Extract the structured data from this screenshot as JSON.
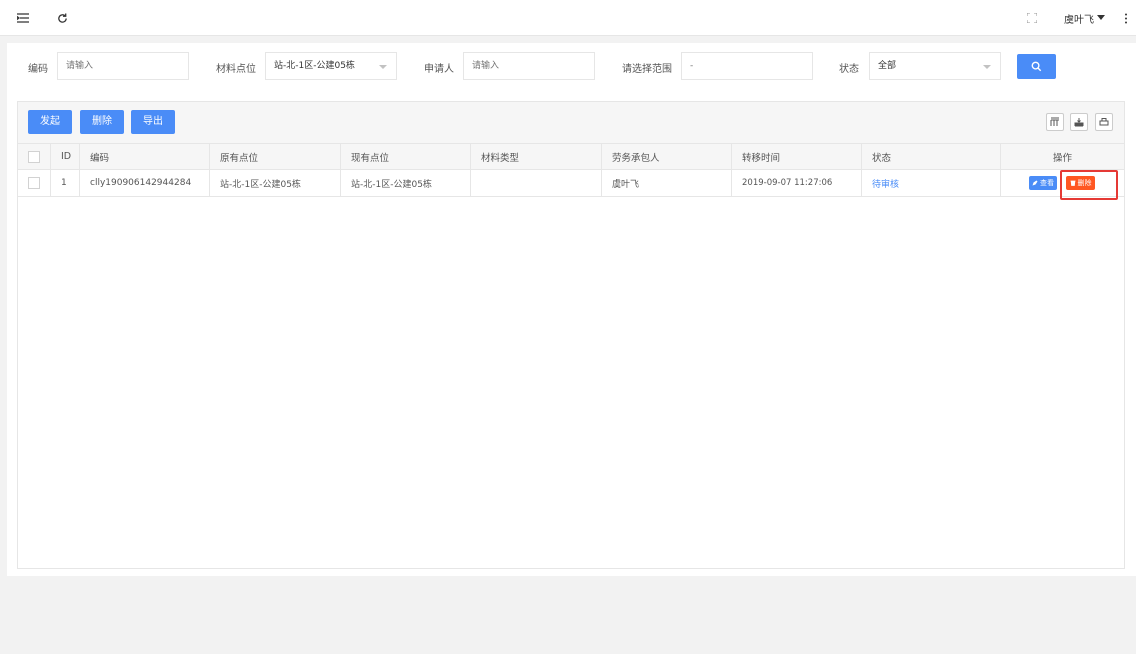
{
  "topbar": {
    "user_name": "虞叶飞"
  },
  "filters": {
    "code_label": "编码",
    "code_placeholder": "请输入",
    "location_label": "材料点位",
    "location_value": "站-北-1区-公建05栋",
    "applicant_label": "申请人",
    "applicant_placeholder": "请输入",
    "range_label": "请选择范围",
    "range_placeholder": "-",
    "status_label": "状态",
    "status_value": "全部"
  },
  "toolbar": {
    "initiate_label": "发起",
    "delete_label": "删除",
    "export_label": "导出"
  },
  "table": {
    "columns": [
      "ID",
      "编码",
      "原有点位",
      "现有点位",
      "材料类型",
      "劳务承包人",
      "转移时间",
      "状态",
      "操作"
    ],
    "rows": [
      {
        "id": "1",
        "code": "clly190906142944284",
        "original_location": "站-北-1区-公建05栋",
        "current_location": "站-北-1区-公建05栋",
        "material_type": "",
        "contractor": "虞叶飞",
        "transfer_time": "2019-09-07 11:27:06",
        "status": "待审核",
        "view_label": "查看",
        "delete_label": "删除"
      }
    ]
  },
  "colors": {
    "primary": "#4a8cf7",
    "danger": "#ff5722",
    "highlight": "#e53935"
  }
}
